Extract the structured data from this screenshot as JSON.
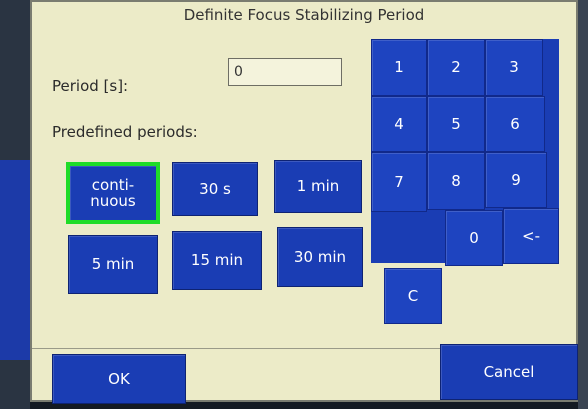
{
  "dialog": {
    "title": "Definite Focus Stabilizing Period",
    "period_label": "Period [s]:",
    "period_value": "0",
    "predefined_label": "Predefined periods:"
  },
  "presets": [
    {
      "label": "conti-\nnuous",
      "selected": true
    },
    {
      "label": "30 s",
      "selected": false
    },
    {
      "label": "1 min",
      "selected": false
    },
    {
      "label": "5 min",
      "selected": false
    },
    {
      "label": "15 min",
      "selected": false
    },
    {
      "label": "30 min",
      "selected": false
    }
  ],
  "keypad": {
    "k1": "1",
    "k2": "2",
    "k3": "3",
    "k4": "4",
    "k5": "5",
    "k6": "6",
    "k7": "7",
    "k8": "8",
    "k9": "9",
    "k0": "0",
    "backspace": "<-",
    "clear": "C"
  },
  "footer": {
    "ok": "OK",
    "cancel": "Cancel"
  },
  "colors": {
    "button_blue": "#1a3db4",
    "dialog_bg": "#ecebc8",
    "selected_border": "#1fdc28"
  }
}
